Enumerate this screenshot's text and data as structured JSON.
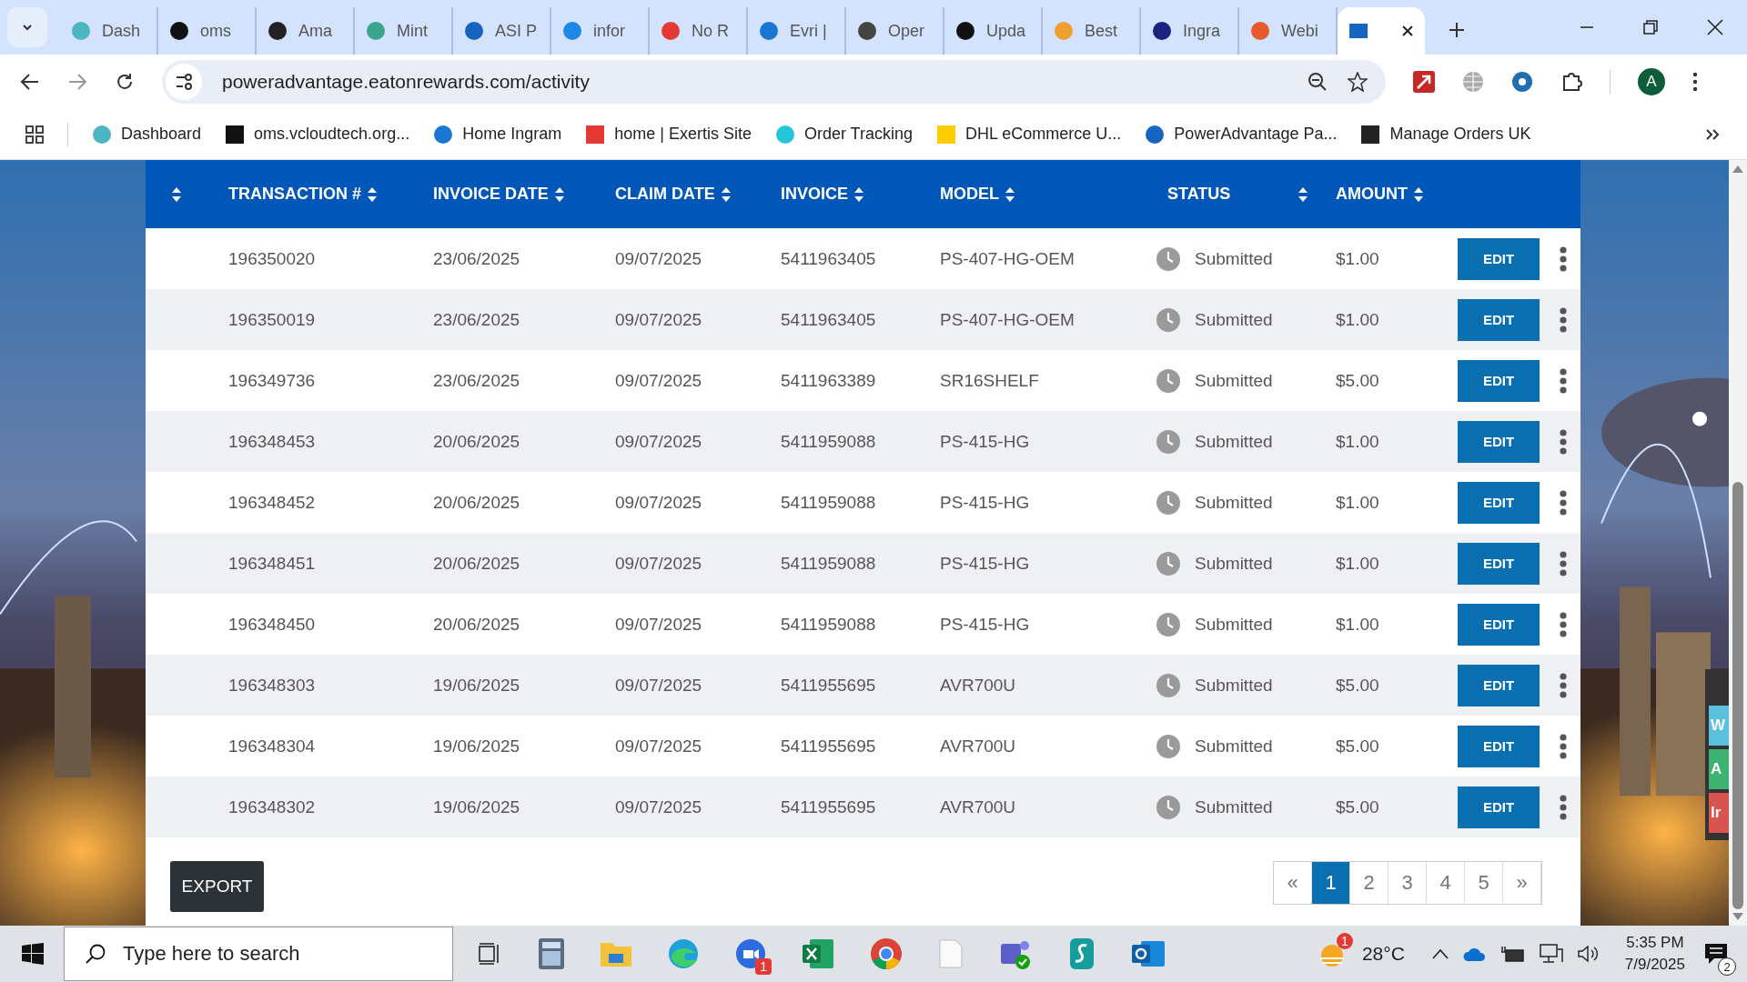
{
  "browser": {
    "tabs": [
      {
        "label": "Dash",
        "selected": false
      },
      {
        "label": "oms",
        "selected": false
      },
      {
        "label": "Ama",
        "selected": false
      },
      {
        "label": "Mint",
        "selected": false
      },
      {
        "label": "ASI P",
        "selected": false
      },
      {
        "label": "infor",
        "selected": false
      },
      {
        "label": "No R",
        "selected": false
      },
      {
        "label": "Evri |",
        "selected": false
      },
      {
        "label": "Oper",
        "selected": false
      },
      {
        "label": "Upda",
        "selected": false
      },
      {
        "label": "Best",
        "selected": false
      },
      {
        "label": "Ingra",
        "selected": false
      },
      {
        "label": "Webi",
        "selected": false
      },
      {
        "selected": true
      }
    ],
    "address": "poweradvantage.eatonrewards.com/activity",
    "avatar": "A",
    "bookmarks": [
      "Dashboard",
      "oms.vcloudtech.org...",
      "Home Ingram",
      "home | Exertis Site",
      "Order Tracking",
      "DHL eCommerce U...",
      "PowerAdvantage Pa...",
      "Manage Orders UK"
    ]
  },
  "table": {
    "columns": [
      "TRANSACTION #",
      "INVOICE DATE",
      "CLAIM DATE",
      "INVOICE",
      "MODEL",
      "STATUS",
      "AMOUNT"
    ],
    "rows": [
      {
        "transaction": "196350020",
        "invoice_date": "23/06/2025",
        "claim_date": "09/07/2025",
        "invoice": "5411963405",
        "model": "PS-407-HG-OEM",
        "status": "Submitted",
        "amount": "$1.00",
        "action": "EDIT"
      },
      {
        "transaction": "196350019",
        "invoice_date": "23/06/2025",
        "claim_date": "09/07/2025",
        "invoice": "5411963405",
        "model": "PS-407-HG-OEM",
        "status": "Submitted",
        "amount": "$1.00",
        "action": "EDIT"
      },
      {
        "transaction": "196349736",
        "invoice_date": "23/06/2025",
        "claim_date": "09/07/2025",
        "invoice": "5411963389",
        "model": "SR16SHELF",
        "status": "Submitted",
        "amount": "$5.00",
        "action": "EDIT"
      },
      {
        "transaction": "196348453",
        "invoice_date": "20/06/2025",
        "claim_date": "09/07/2025",
        "invoice": "5411959088",
        "model": "PS-415-HG",
        "status": "Submitted",
        "amount": "$1.00",
        "action": "EDIT"
      },
      {
        "transaction": "196348452",
        "invoice_date": "20/06/2025",
        "claim_date": "09/07/2025",
        "invoice": "5411959088",
        "model": "PS-415-HG",
        "status": "Submitted",
        "amount": "$1.00",
        "action": "EDIT"
      },
      {
        "transaction": "196348451",
        "invoice_date": "20/06/2025",
        "claim_date": "09/07/2025",
        "invoice": "5411959088",
        "model": "PS-415-HG",
        "status": "Submitted",
        "amount": "$1.00",
        "action": "EDIT"
      },
      {
        "transaction": "196348450",
        "invoice_date": "20/06/2025",
        "claim_date": "09/07/2025",
        "invoice": "5411959088",
        "model": "PS-415-HG",
        "status": "Submitted",
        "amount": "$1.00",
        "action": "EDIT"
      },
      {
        "transaction": "196348303",
        "invoice_date": "19/06/2025",
        "claim_date": "09/07/2025",
        "invoice": "5411955695",
        "model": "AVR700U",
        "status": "Submitted",
        "amount": "$5.00",
        "action": "EDIT"
      },
      {
        "transaction": "196348304",
        "invoice_date": "19/06/2025",
        "claim_date": "09/07/2025",
        "invoice": "5411955695",
        "model": "AVR700U",
        "status": "Submitted",
        "amount": "$5.00",
        "action": "EDIT"
      },
      {
        "transaction": "196348302",
        "invoice_date": "19/06/2025",
        "claim_date": "09/07/2025",
        "invoice": "5411955695",
        "model": "AVR700U",
        "status": "Submitted",
        "amount": "$5.00",
        "action": "EDIT"
      }
    ]
  },
  "export_button": "EXPORT",
  "pagination": [
    {
      "label": "«",
      "selected": false
    },
    {
      "label": "1",
      "selected": true
    },
    {
      "label": "2",
      "selected": false
    },
    {
      "label": "3",
      "selected": false
    },
    {
      "label": "4",
      "selected": false
    },
    {
      "label": "5",
      "selected": false
    },
    {
      "label": "»",
      "selected": false
    }
  ],
  "side_widget": [
    "W",
    "A",
    "Ir"
  ],
  "taskbar": {
    "search_placeholder": "Type here to search",
    "zoom_badge": "1",
    "weather_badge": "1",
    "temperature": "28°C",
    "time": "5:35 PM",
    "date": "7/9/2025",
    "notifications": "2"
  }
}
